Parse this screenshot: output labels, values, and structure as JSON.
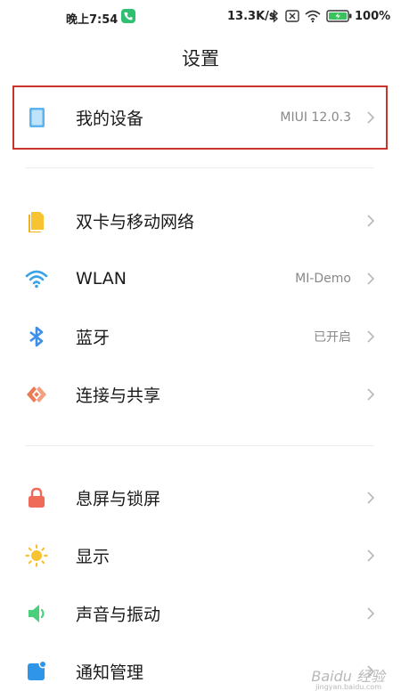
{
  "status_bar": {
    "time": "晚上7:54",
    "net_speed": "13.3K/s",
    "battery": "100%"
  },
  "page": {
    "title": "设置"
  },
  "items": [
    {
      "label": "我的设备",
      "value": "MIUI 12.0.3",
      "icon": "device-icon",
      "color": "#5ab4f0"
    },
    {
      "label": "双卡与移动网络",
      "value": "",
      "icon": "sim-card-icon",
      "color": "#f7c331"
    },
    {
      "label": "WLAN",
      "value": "MI-Demo",
      "icon": "wifi-icon",
      "color": "#3aa3e8"
    },
    {
      "label": "蓝牙",
      "value": "已开启",
      "icon": "bluetooth-icon",
      "color": "#3d8fe8"
    },
    {
      "label": "连接与共享",
      "value": "",
      "icon": "share-icon",
      "color": "#e97b55"
    },
    {
      "label": "息屏与锁屏",
      "value": "",
      "icon": "lock-icon",
      "color": "#f06a5a"
    },
    {
      "label": "显示",
      "value": "",
      "icon": "sun-icon",
      "color": "#f7c331"
    },
    {
      "label": "声音与振动",
      "value": "",
      "icon": "speaker-icon",
      "color": "#4ccf7a"
    },
    {
      "label": "通知管理",
      "value": "",
      "icon": "notification-icon",
      "color": "#2f95e8"
    }
  ],
  "highlight_color": "#c8332c",
  "watermark": {
    "text": "Baidu 经验",
    "url": "jingyan.baidu.com"
  }
}
